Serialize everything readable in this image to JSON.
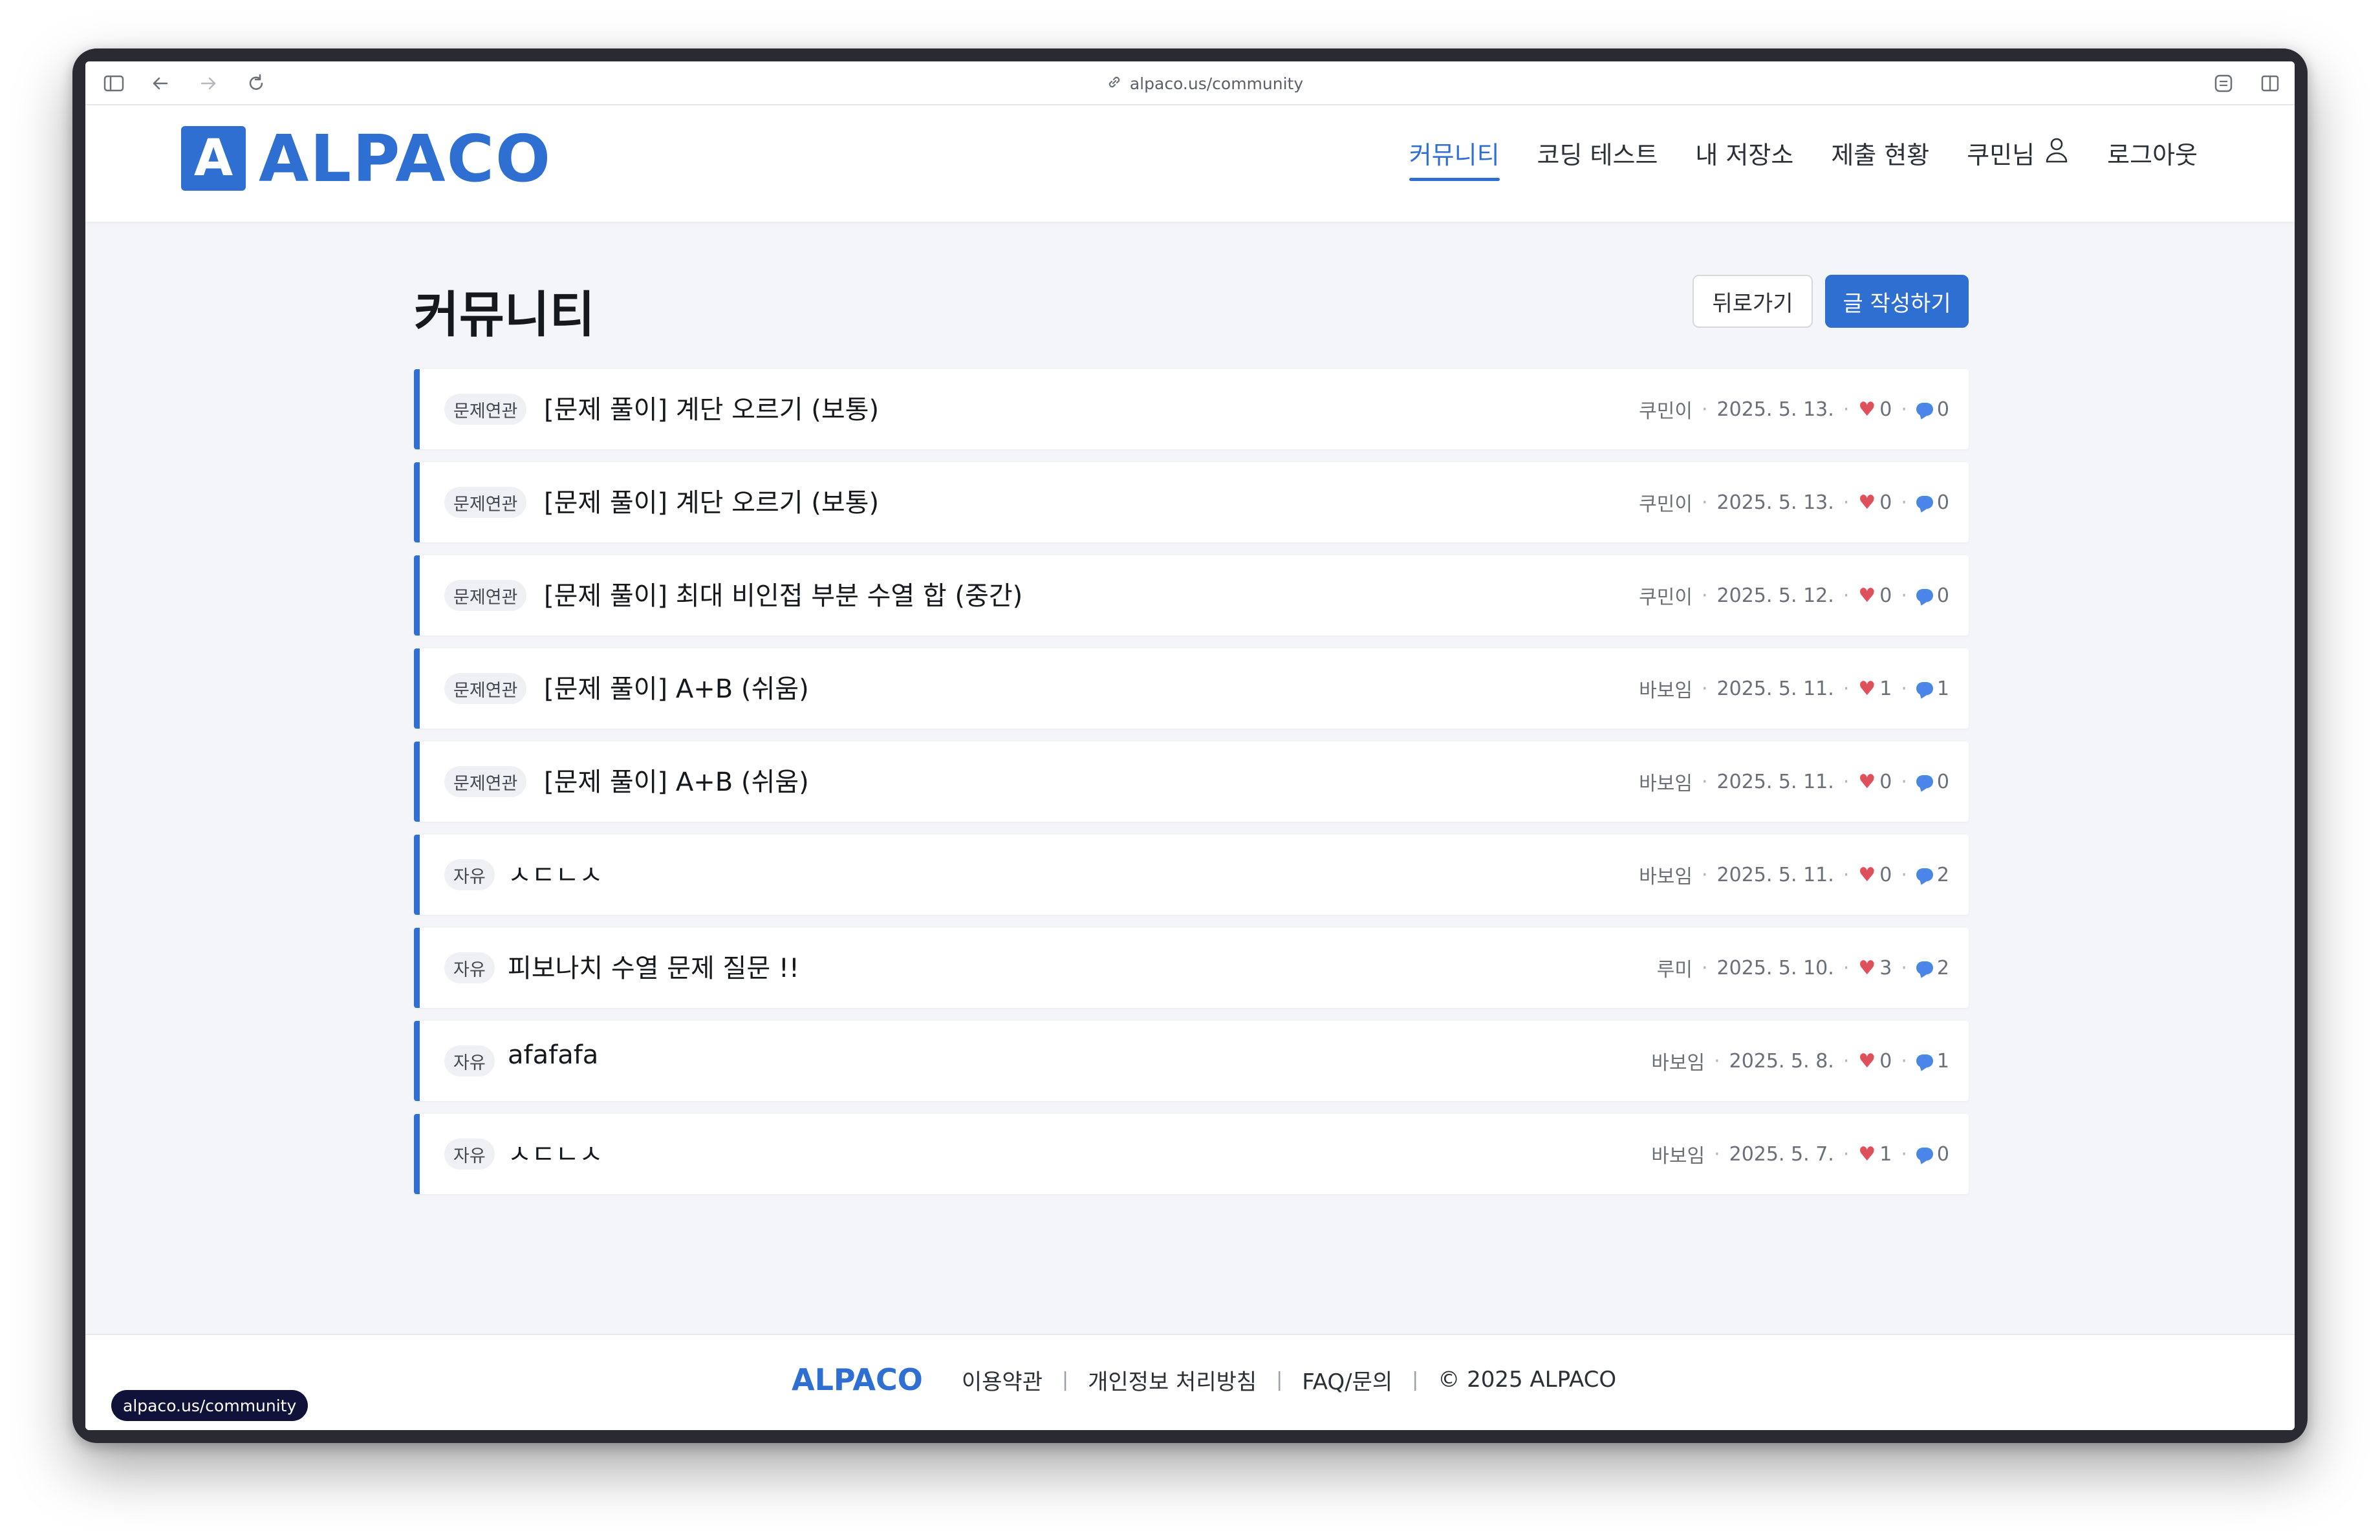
{
  "browser": {
    "url": "alpaco.us/community",
    "status_url": "alpaco.us/community"
  },
  "brand": {
    "logo_mark": "A",
    "name": "ALPACO",
    "accent_color": "#2f6fd1"
  },
  "nav": {
    "items": [
      {
        "label": "커뮤니티",
        "active": true
      },
      {
        "label": "코딩 테스트",
        "active": false
      },
      {
        "label": "내 저장소",
        "active": false
      },
      {
        "label": "제출 현황",
        "active": false
      },
      {
        "label": "쿠민님",
        "active": false,
        "icon": "user-icon"
      },
      {
        "label": "로그아웃",
        "active": false
      }
    ]
  },
  "page": {
    "title": "커뮤니티",
    "back_label": "뒤로가기",
    "write_label": "글 작성하기"
  },
  "posts": [
    {
      "category": "문제연관",
      "title": "[문제 풀이] 계단 오르기 (보통)",
      "author": "쿠민이",
      "date": "2025. 5. 13.",
      "likes": "0",
      "comments": "0"
    },
    {
      "category": "문제연관",
      "title": "[문제 풀이] 계단 오르기 (보통)",
      "author": "쿠민이",
      "date": "2025. 5. 13.",
      "likes": "0",
      "comments": "0"
    },
    {
      "category": "문제연관",
      "title": "[문제 풀이] 최대 비인접 부분 수열 합 (중간)",
      "author": "쿠민이",
      "date": "2025. 5. 12.",
      "likes": "0",
      "comments": "0"
    },
    {
      "category": "문제연관",
      "title": "[문제 풀이] A+B (쉬움)",
      "author": "바보임",
      "date": "2025. 5. 11.",
      "likes": "1",
      "comments": "1"
    },
    {
      "category": "문제연관",
      "title": "[문제 풀이] A+B (쉬움)",
      "author": "바보임",
      "date": "2025. 5. 11.",
      "likes": "0",
      "comments": "0"
    },
    {
      "category": "자유",
      "title": "ㅅㄷㄴㅅ",
      "author": "바보임",
      "date": "2025. 5. 11.",
      "likes": "0",
      "comments": "2"
    },
    {
      "category": "자유",
      "title": "피보나치 수열 문제 질문 !!",
      "author": "루미",
      "date": "2025. 5. 10.",
      "likes": "3",
      "comments": "2"
    },
    {
      "category": "자유",
      "title": "afafafa",
      "author": "바보임",
      "date": "2025. 5. 8.",
      "likes": "0",
      "comments": "1"
    },
    {
      "category": "자유",
      "title": "ㅅㄷㄴㅅ",
      "author": "바보임",
      "date": "2025. 5. 7.",
      "likes": "1",
      "comments": "0"
    }
  ],
  "footer": {
    "logo": "ALPACO",
    "links": [
      "이용약관",
      "개인정보 처리방침",
      "FAQ/문의"
    ],
    "separator": "|",
    "copyright": "© 2025 ALPACO"
  }
}
